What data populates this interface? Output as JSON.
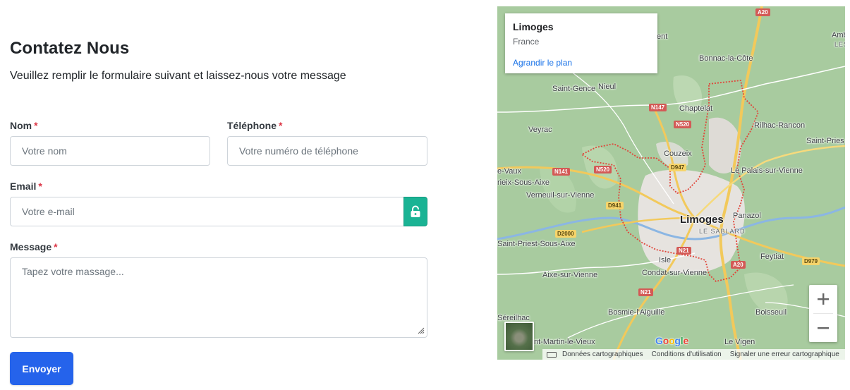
{
  "form": {
    "title": "Contatez Nous",
    "subtitle": "Veuillez remplir le formulaire suivant et laissez-nous votre message",
    "required_mark": "*",
    "name": {
      "label": "Nom",
      "placeholder": "Votre nom"
    },
    "phone": {
      "label": "Téléphone",
      "placeholder": "Votre numéro de téléphone"
    },
    "email": {
      "label": "Email",
      "placeholder": "Votre e-mail"
    },
    "message": {
      "label": "Message",
      "placeholder": "Tapez votre massage..."
    },
    "submit_label": "Envoyer"
  },
  "map": {
    "info": {
      "title": "Limoges",
      "subtitle": "France",
      "link": "Agrandir le plan"
    },
    "places": {
      "limoges": "Limoges",
      "le_sablard": "LE SABLARD",
      "bonnac": "Bonnac-la-Côte",
      "ambazac_frag": "Amb",
      "les_frag": "LES",
      "ent_frag": "ent",
      "saint_gence": "Saint-Gence",
      "nieul": "Nieul",
      "chaptelat": "Chaptelat",
      "rilhac": "Rilhac-Rancon",
      "veyrac": "Veyrac",
      "saint_pries_frag": "Saint-Pries",
      "couzeix": "Couzeix",
      "le_palais": "Le Palais-sur-Vienne",
      "vaux_frag": "e-Vaux",
      "rieix_frag": "rieix-Sous-Aixe",
      "verneuil": "Verneuil-sur-Vienne",
      "panazol": "Panazol",
      "saint_priest": "Saint-Priest-Sous-Aixe",
      "isle": "Isle",
      "feytiat": "Feytiat",
      "condat": "Condat-sur-Vienne",
      "aixe": "Aixe-sur-Vienne",
      "bosmie": "Bosmie-l'Aiguille",
      "boisseuil": "Boisseuil",
      "sereilhac": "Séreilhac",
      "saint_martin": "nt-Martin-le-Vieux",
      "le_vigen": "Le Vigen"
    },
    "roads": {
      "a20_top": "A20",
      "n147": "N147",
      "n520_a": "N520",
      "n520_b": "N520",
      "n141": "N141",
      "d947": "D947",
      "d941": "D941",
      "d2000": "D2000",
      "n21_a": "N21",
      "a20_bottom": "A20",
      "d979": "D979",
      "n21_b": "N21"
    },
    "google_logo": "Google",
    "footer": {
      "map_data": "Données cartographiques",
      "terms": "Conditions d'utilisation",
      "report": "Signaler une erreur cartographique"
    },
    "colors": {
      "accent_button": "#2563eb",
      "lock_button": "#1ab394",
      "boundary": "#e0453a"
    }
  }
}
